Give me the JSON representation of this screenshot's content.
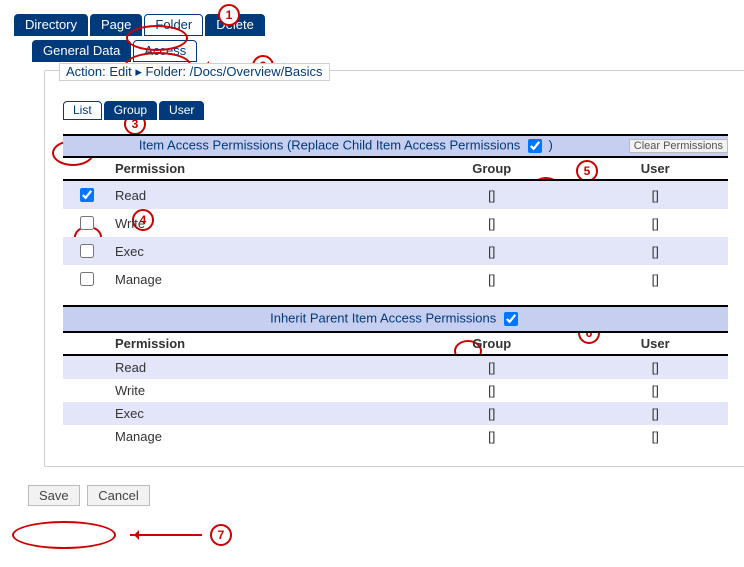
{
  "mainTabs": [
    "Directory",
    "Page",
    "Folder",
    "Delete"
  ],
  "mainSel": 2,
  "subTabs": [
    "General Data",
    "Access"
  ],
  "subSel": 1,
  "crumb": "Action: Edit ▸ Folder: /Docs/Overview/Basics",
  "viewTabs": [
    "List",
    "Group",
    "User"
  ],
  "viewSel": 0,
  "sec1": {
    "title": "Item Access Permissions (Replace Child Item Access Permissions",
    "replace": true,
    "clear": "Clear Permissions",
    "cols": [
      "Permission",
      "Group",
      "User"
    ],
    "rows": [
      {
        "chk": true,
        "p": "Read",
        "g": "[]",
        "u": "[]"
      },
      {
        "chk": false,
        "p": "Write",
        "g": "[]",
        "u": "[]"
      },
      {
        "chk": false,
        "p": "Exec",
        "g": "[]",
        "u": "[]"
      },
      {
        "chk": false,
        "p": "Manage",
        "g": "[]",
        "u": "[]"
      }
    ]
  },
  "sec2": {
    "title": "Inherit Parent Item Access Permissions",
    "inherit": true,
    "cols": [
      "Permission",
      "Group",
      "User"
    ],
    "rows": [
      {
        "p": "Read",
        "g": "[]",
        "u": "[]"
      },
      {
        "p": "Write",
        "g": "[]",
        "u": "[]"
      },
      {
        "p": "Exec",
        "g": "[]",
        "u": "[]"
      },
      {
        "p": "Manage",
        "g": "[]",
        "u": "[]"
      }
    ]
  },
  "save": "Save",
  "cancel": "Cancel",
  "callouts": {
    "1": "1",
    "2": "2",
    "3": "3",
    "4": "4",
    "5": "5",
    "6": "6",
    "7": "7"
  }
}
